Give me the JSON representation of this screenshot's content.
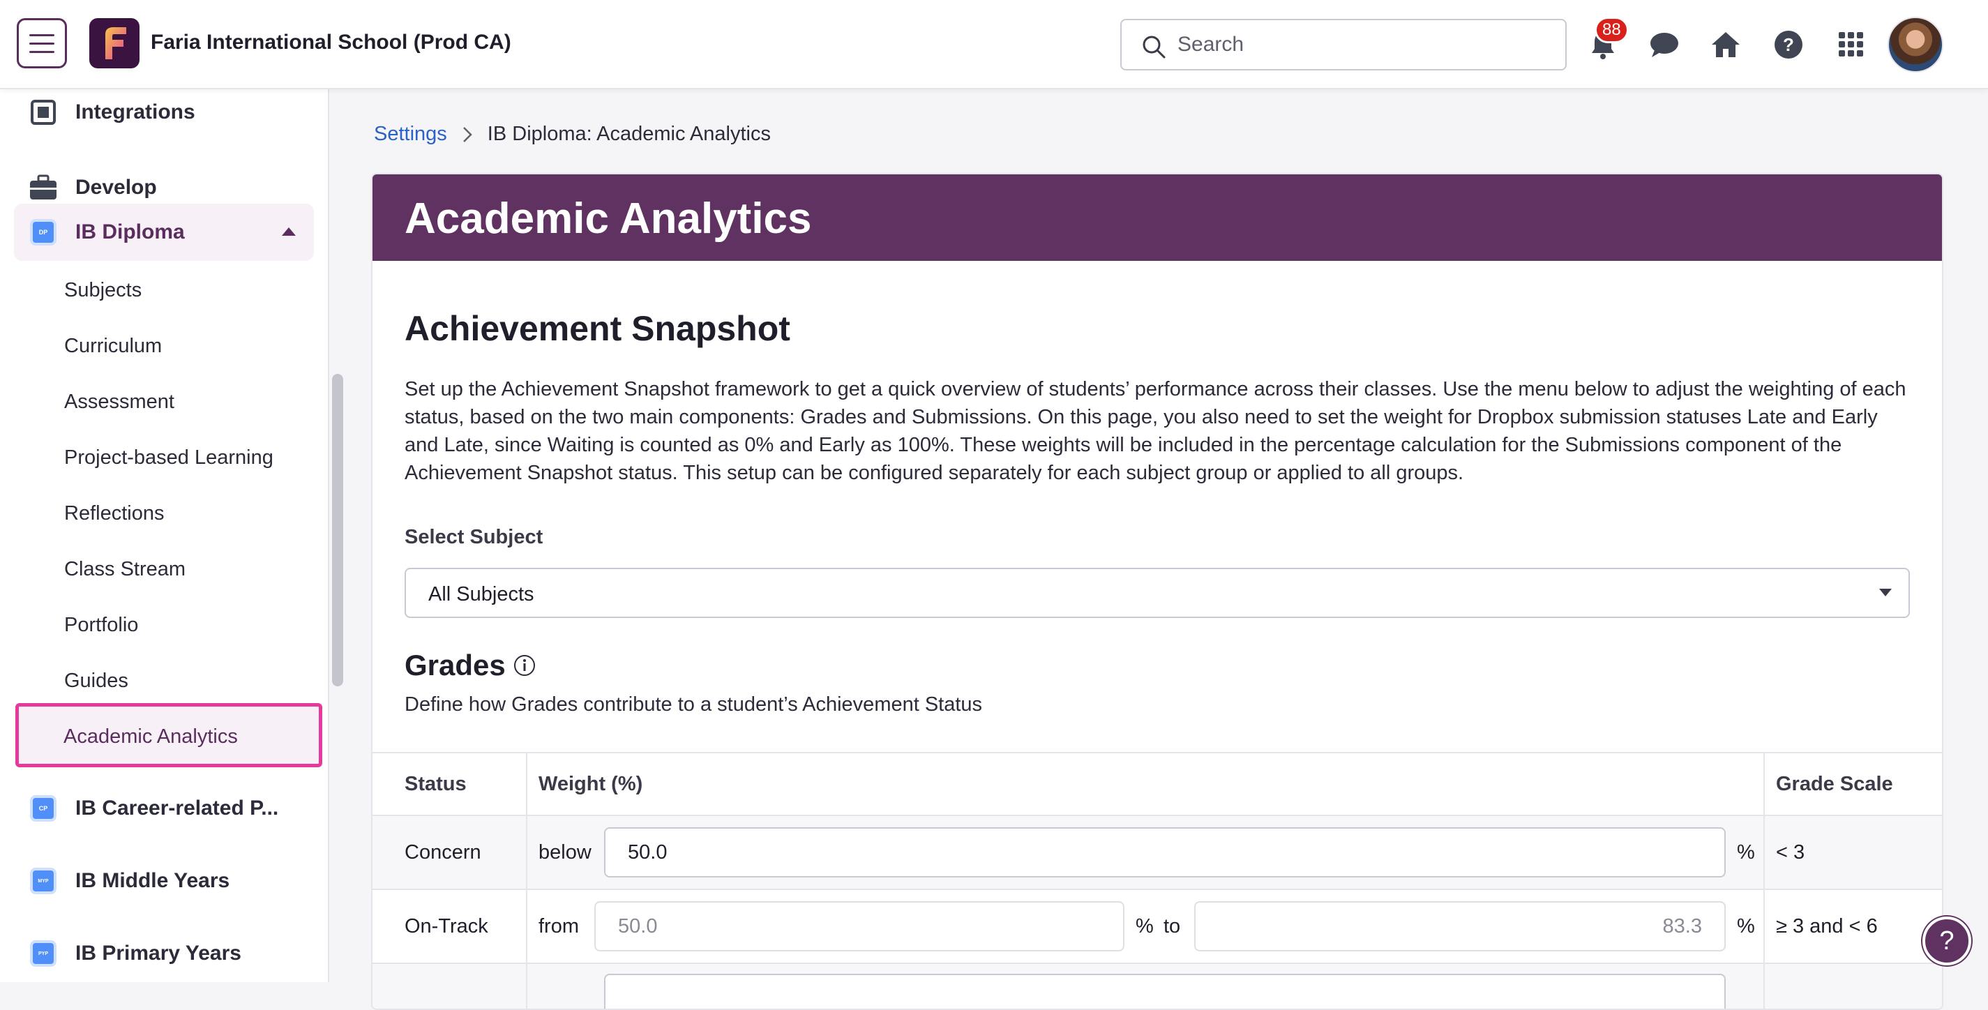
{
  "header": {
    "school_name": "Faria International School (Prod CA)",
    "search_placeholder": "Search",
    "notification_count": "88"
  },
  "sidebar": {
    "top_items": [
      {
        "label": "Integrations"
      },
      {
        "label": "Develop"
      }
    ],
    "ib_diploma": {
      "label": "IB Diploma",
      "icon_text": "DP",
      "subitems": [
        "Subjects",
        "Curriculum",
        "Assessment",
        "Project-based Learning",
        "Reflections",
        "Class Stream",
        "Portfolio",
        "Guides"
      ],
      "active": "Academic Analytics"
    },
    "programs": [
      {
        "label": "IB Career-related P...",
        "icon_text": "CP"
      },
      {
        "label": "IB Middle Years",
        "icon_text": "MYP"
      },
      {
        "label": "IB Primary Years",
        "icon_text": "PYP"
      }
    ]
  },
  "breadcrumb": {
    "root": "Settings",
    "current": "IB Diploma: Academic Analytics"
  },
  "page": {
    "title": "Academic Analytics",
    "section_title": "Achievement Snapshot",
    "description": "Set up the Achievement Snapshot framework to get a quick overview of students’ performance across their classes. Use the menu below to adjust the weighting of each status, based on the two main components: Grades and Submissions. On this page, you also need to set the weight for Dropbox submission statuses Late and Early and Late, since Waiting is counted as 0% and Early as 100%. These weights will be included in the percentage calculation for the Submissions component of the Achievement Snapshot status. This setup can be configured separately for each subject group or applied to all groups.",
    "select_label": "Select Subject",
    "select_value": "All Subjects",
    "grades_title": "Grades",
    "grades_desc": "Define how Grades contribute to a student’s Achievement Status"
  },
  "grades_table": {
    "headers": {
      "status": "Status",
      "weight": "Weight (%)",
      "scale": "Grade Scale"
    },
    "rows": [
      {
        "status": "Concern",
        "prefix": "below",
        "value": "50.0",
        "unit": "%",
        "scale": "< 3"
      },
      {
        "status": "On-Track",
        "prefix": "from",
        "from_value": "50.0",
        "from_unit": "%",
        "to_label": "to",
        "to_value": "83.3",
        "to_unit": "%",
        "scale": "≥ 3 and < 6"
      }
    ]
  }
}
